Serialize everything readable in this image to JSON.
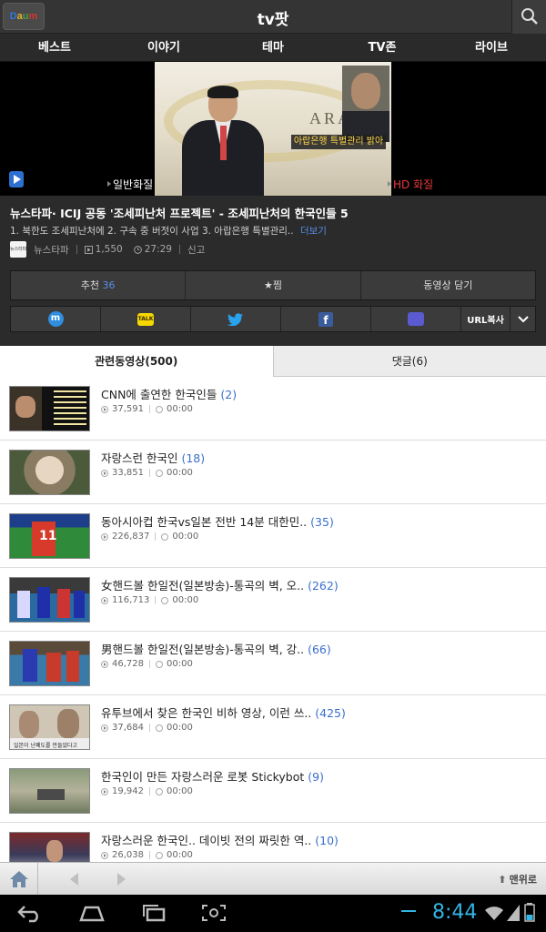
{
  "app": {
    "title": "tv팟",
    "logo_text": "Daum"
  },
  "nav": [
    "베스트",
    "이야기",
    "테마",
    "TV존",
    "라이브"
  ],
  "player": {
    "caption": "아랍은행 특별관리 밝아",
    "quality_normal": "일반화질",
    "quality_hd": "HD 화질"
  },
  "video": {
    "title": "뉴스타파· ICIJ 공동 '조세피난처 프로젝트' - 조세피난처의 한국인들 5",
    "description": "1. 북한도 조세피난처에 2. 구속 중 버젓이 사업 3. 아랍은행 특별관리..",
    "more_label": "더보기",
    "channel": "뉴스타파",
    "views": "1,550",
    "duration": "27:29",
    "report_label": "신고"
  },
  "actions": {
    "recommend_label": "추천",
    "recommend_count": "36",
    "favorite_label": "★찜",
    "save_label": "동영상 담기"
  },
  "share": {
    "url_copy_label": "URL복사"
  },
  "tabs": {
    "related": "관련동영상(500)",
    "comments": "댓글(6)"
  },
  "related": [
    {
      "title": "CNN에 출연한 한국인들",
      "count": "(2)",
      "views": "37,591",
      "time": "00:00"
    },
    {
      "title": "자랑스런 한국인",
      "count": "(18)",
      "views": "33,851",
      "time": "00:00"
    },
    {
      "title": "동아시아컵 한국vs일본 전반 14분 대한민..",
      "count": "(35)",
      "views": "226,837",
      "time": "00:00"
    },
    {
      "title": "女핸드볼 한일전(일본방송)-통곡의 벽, 오..",
      "count": "(262)",
      "views": "116,713",
      "time": "00:00"
    },
    {
      "title": "男핸드볼 한일전(일본방송)-통곡의 벽, 강..",
      "count": "(66)",
      "views": "46,728",
      "time": "00:00"
    },
    {
      "title": "유투브에서 찾은 한국인 비하 영상, 이런 쓰..",
      "count": "(425)",
      "views": "37,684",
      "time": "00:00"
    },
    {
      "title": "한국인이 만든 자랑스러운 로봇 Stickybot",
      "count": "(9)",
      "views": "19,942",
      "time": "00:00"
    },
    {
      "title": "자랑스러운 한국인.. 데이빗 전의 짜릿한 역..",
      "count": "(10)",
      "views": "26,038",
      "time": "00:00"
    }
  ],
  "bottom": {
    "to_top_label": "맨위로"
  },
  "system": {
    "clock": "8:44"
  },
  "colors": {
    "accent": "#3a6fcf",
    "hd": "#e53a3a",
    "clock": "#33b5e5"
  }
}
